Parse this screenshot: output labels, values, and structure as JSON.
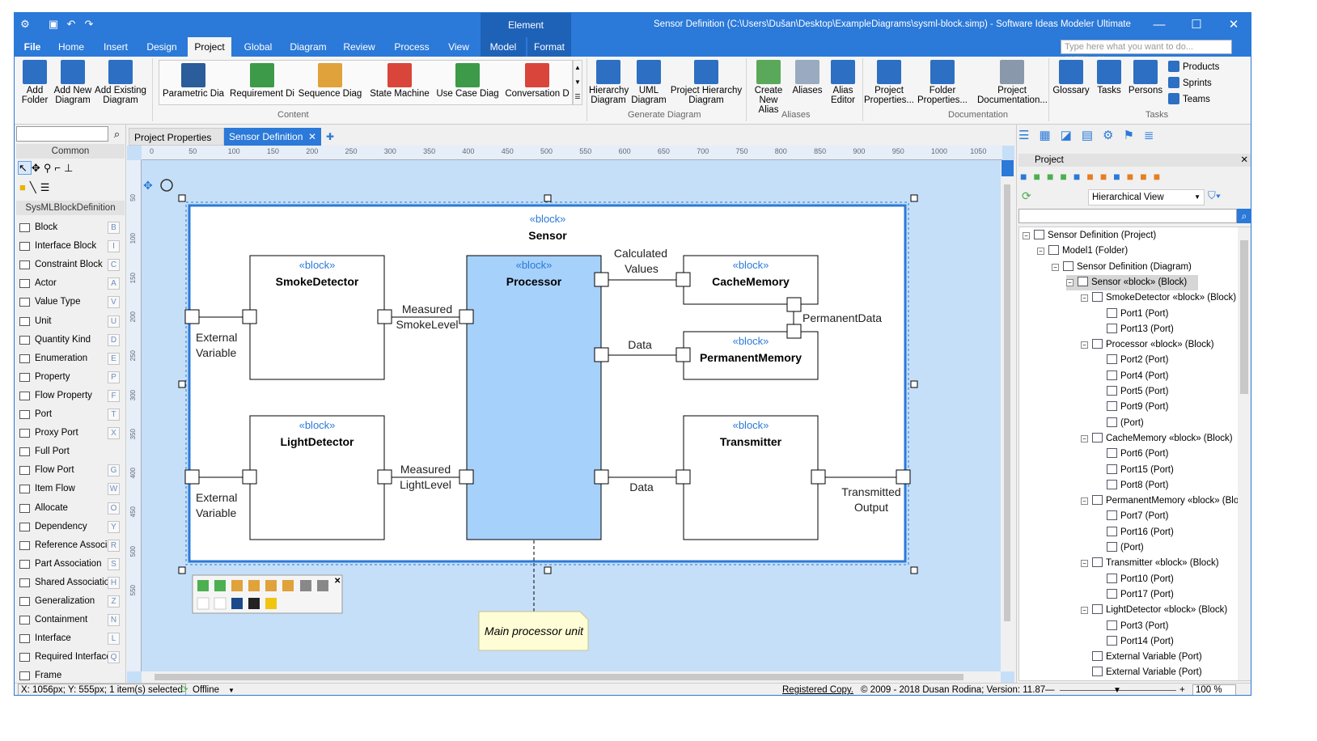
{
  "titlebar": {
    "context_tab": "Element",
    "title": "Sensor Definition (C:\\Users\\Dušan\\Desktop\\ExampleDiagrams\\sysml-block.simp) - Software Ideas Modeler Ultimate",
    "min": "—",
    "max": "☐",
    "close": "✕"
  },
  "menu": {
    "tabs": [
      "File",
      "Home",
      "Insert",
      "Design",
      "Project",
      "Global",
      "Diagram",
      "Review",
      "Process",
      "View",
      "Model",
      "Format"
    ],
    "search_placeholder": "Type here what you want to do... (CTRL+Q)"
  },
  "ribbon": {
    "add_folder": "Add Folder",
    "add_new_diagram": "Add New Diagram",
    "add_existing_diagram": "Add Existing Diagram",
    "content": [
      "Parametric Dia",
      "Requirement Di",
      "Sequence Diag",
      "State Machine",
      "Use Case Diag",
      "Conversation D"
    ],
    "generate": [
      "Hierarchy Diagram",
      "UML Diagram",
      "Project Hierarchy Diagram"
    ],
    "aliases": [
      "Create New Alias",
      "Aliases",
      "Alias Editor"
    ],
    "documentation": [
      "Project Properties...",
      "Folder Properties...",
      "Project Documentation..."
    ],
    "tasks_big": [
      "Glossary",
      "Tasks",
      "Persons"
    ],
    "tasks_small": [
      "Products",
      "Sprints",
      "Teams"
    ],
    "groups": [
      "Content",
      "Generate Diagram",
      "Aliases",
      "Documentation",
      "Tasks"
    ]
  },
  "toolbox": {
    "header_common": "Common",
    "header_section": "SysMLBlockDefinition",
    "items": [
      {
        "label": "Block",
        "key": "B"
      },
      {
        "label": "Interface Block",
        "key": "I"
      },
      {
        "label": "Constraint Block",
        "key": "C"
      },
      {
        "label": "Actor",
        "key": "A"
      },
      {
        "label": "Value Type",
        "key": "V"
      },
      {
        "label": "Unit",
        "key": "U"
      },
      {
        "label": "Quantity Kind",
        "key": "D"
      },
      {
        "label": "Enumeration",
        "key": "E"
      },
      {
        "label": "Property",
        "key": "P"
      },
      {
        "label": "Flow Property",
        "key": "F"
      },
      {
        "label": "Port",
        "key": "T"
      },
      {
        "label": "Proxy Port",
        "key": "X"
      },
      {
        "label": "Full Port",
        "key": ""
      },
      {
        "label": "Flow Port",
        "key": "G"
      },
      {
        "label": "Item Flow",
        "key": "W"
      },
      {
        "label": "Allocate",
        "key": "O"
      },
      {
        "label": "Dependency",
        "key": "Y"
      },
      {
        "label": "Reference Associa",
        "key": "R"
      },
      {
        "label": "Part Association",
        "key": "S"
      },
      {
        "label": "Shared Association",
        "key": "H"
      },
      {
        "label": "Generalization",
        "key": "Z"
      },
      {
        "label": "Containment",
        "key": "N"
      },
      {
        "label": "Interface",
        "key": "L"
      },
      {
        "label": "Required Interface",
        "key": "Q"
      },
      {
        "label": "Frame",
        "key": ""
      }
    ]
  },
  "doc_tabs": {
    "tab1": "Project Properties",
    "tab2": "Sensor Definition",
    "close": "✕",
    "add": "✚"
  },
  "ruler": {
    "h": [
      "0",
      "50",
      "100",
      "150",
      "200",
      "250",
      "300",
      "350",
      "400",
      "450",
      "500",
      "550",
      "600",
      "650",
      "700",
      "750",
      "800",
      "850",
      "900",
      "950",
      "1000",
      "1050"
    ],
    "v": [
      "50",
      "100",
      "150",
      "200",
      "250",
      "300",
      "350",
      "400",
      "450",
      "500",
      "550"
    ]
  },
  "diagram": {
    "stereotype": "«block»",
    "container": "Sensor",
    "blocks": {
      "smoke": "SmokeDetector",
      "processor": "Processor",
      "cache": "CacheMemory",
      "perm": "PermanentMemory",
      "light": "LightDetector",
      "trans": "Transmitter"
    },
    "labels": {
      "ext1a": "External",
      "ext1b": "Variable",
      "ext2a": "External",
      "ext2b": "Variable",
      "msl_a": "Measured",
      "msl_b": "SmokeLevel",
      "mll_a": "Measured",
      "mll_b": "LightLevel",
      "cv_a": "Calculated",
      "cv_b": "Values",
      "data1": "Data",
      "data2": "Data",
      "permdata": "PermanentData",
      "to_a": "Transmitted",
      "to_b": "Output"
    },
    "note": "Main processor unit"
  },
  "project_panel": {
    "title": "Project",
    "view_select": "Hierarchical View",
    "tree": [
      {
        "label": "Sensor Definition (Project)",
        "level": 0,
        "exp": "−"
      },
      {
        "label": "Model1 (Folder)",
        "level": 1,
        "exp": "−"
      },
      {
        "label": "Sensor Definition (Diagram)",
        "level": 2,
        "exp": "−"
      },
      {
        "label": "Sensor «block» (Block)",
        "level": 3,
        "exp": "−",
        "sel": true
      },
      {
        "label": "SmokeDetector «block» (Block)",
        "level": 4,
        "exp": "−"
      },
      {
        "label": "Port1 (Port)",
        "level": 5,
        "exp": ""
      },
      {
        "label": "Port13 (Port)",
        "level": 5,
        "exp": ""
      },
      {
        "label": "Processor «block» (Block)",
        "level": 4,
        "exp": "−"
      },
      {
        "label": "Port2 (Port)",
        "level": 5,
        "exp": ""
      },
      {
        "label": "Port4 (Port)",
        "level": 5,
        "exp": ""
      },
      {
        "label": "Port5 (Port)",
        "level": 5,
        "exp": ""
      },
      {
        "label": "Port9 (Port)",
        "level": 5,
        "exp": ""
      },
      {
        "label": "(Port)",
        "level": 5,
        "exp": ""
      },
      {
        "label": "CacheMemory «block» (Block)",
        "level": 4,
        "exp": "−"
      },
      {
        "label": "Port6 (Port)",
        "level": 5,
        "exp": ""
      },
      {
        "label": "Port15 (Port)",
        "level": 5,
        "exp": ""
      },
      {
        "label": "Port8 (Port)",
        "level": 5,
        "exp": ""
      },
      {
        "label": "PermanentMemory «block» (Blo",
        "level": 4,
        "exp": "−"
      },
      {
        "label": "Port7 (Port)",
        "level": 5,
        "exp": ""
      },
      {
        "label": "Port16 (Port)",
        "level": 5,
        "exp": ""
      },
      {
        "label": "(Port)",
        "level": 5,
        "exp": ""
      },
      {
        "label": "Transmitter «block» (Block)",
        "level": 4,
        "exp": "−"
      },
      {
        "label": "Port10 (Port)",
        "level": 5,
        "exp": ""
      },
      {
        "label": "Port17 (Port)",
        "level": 5,
        "exp": ""
      },
      {
        "label": "LightDetector «block» (Block)",
        "level": 4,
        "exp": "−"
      },
      {
        "label": "Port3 (Port)",
        "level": 5,
        "exp": ""
      },
      {
        "label": "Port14 (Port)",
        "level": 5,
        "exp": ""
      },
      {
        "label": "External Variable (Port)",
        "level": 4,
        "exp": ""
      },
      {
        "label": "External Variable (Port)",
        "level": 4,
        "exp": ""
      }
    ]
  },
  "status": {
    "coords": "X: 1056px; Y: 555px; 1 item(s) selected",
    "offline": "Offline",
    "registered": "Registered Copy.",
    "copyright": "© 2009 - 2018 Dusan Rodina; Version: 11.87",
    "zoom": "100 %",
    "zoom_minus": "—",
    "zoom_plus": "+"
  },
  "colors": {
    "accent": "#2b79d8",
    "processor_fill": "#a6d1fb",
    "canvas_bg": "#c6dff8",
    "note_bg": "#fffdd5"
  }
}
